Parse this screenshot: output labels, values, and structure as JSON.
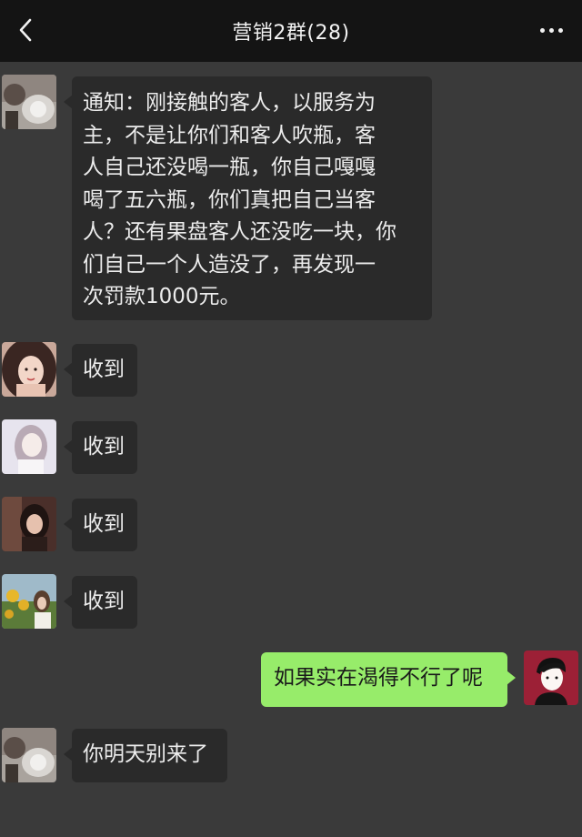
{
  "header": {
    "title": "营销2群(28)",
    "back_icon": "chevron-left-icon",
    "more_icon": "more-horizontal-icon"
  },
  "messages": [
    {
      "sender": "other",
      "avatar": "avatar-1",
      "text": "通知：刚接触的客人，以服务为\n主，不是让你们和客人吹瓶，客\n人自己还没喝一瓶，你自己嘎嘎\n喝了五六瓶，你们真把自己当客\n人？还有果盘客人还没吃一块，你\n们自己一个人造没了，再发现一\n次罚款1000元。"
    },
    {
      "sender": "other",
      "avatar": "avatar-2",
      "text": "收到"
    },
    {
      "sender": "other",
      "avatar": "avatar-3",
      "text": "收到"
    },
    {
      "sender": "other",
      "avatar": "avatar-4",
      "text": "收到"
    },
    {
      "sender": "other",
      "avatar": "avatar-5",
      "text": "收到"
    },
    {
      "sender": "self",
      "avatar": "avatar-self",
      "text": "如果实在渴得不行了呢"
    },
    {
      "sender": "other",
      "avatar": "avatar-1",
      "text": "你明天别来了"
    }
  ],
  "colors": {
    "background": "#3a3a3a",
    "navbar": "#141414",
    "bubble_other": "#2a2a2a",
    "bubble_self": "#97ec6a"
  }
}
